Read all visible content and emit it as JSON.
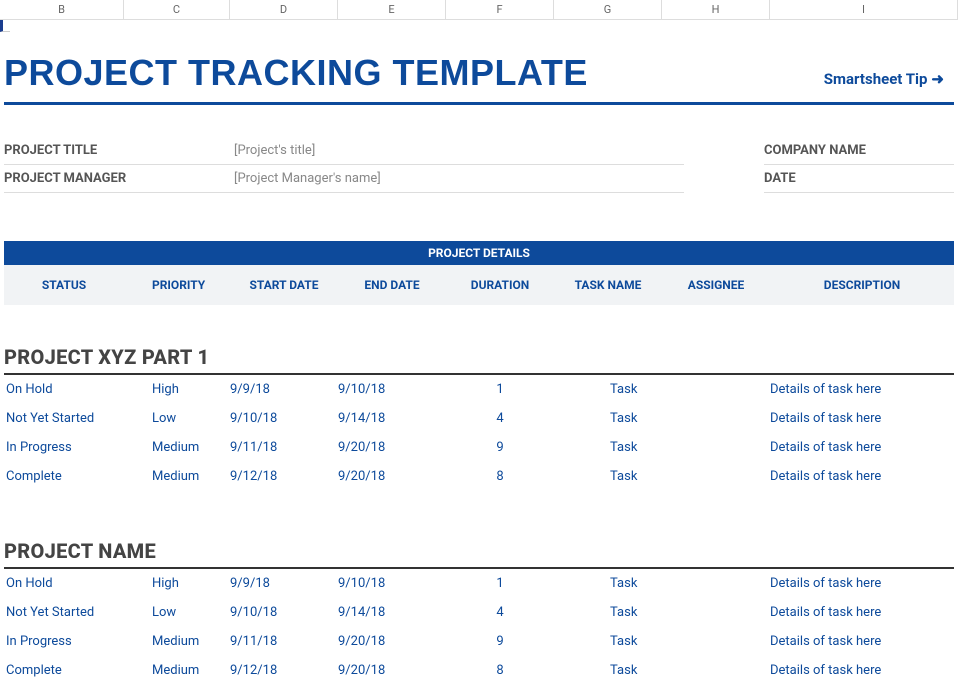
{
  "columns": [
    "B",
    "C",
    "D",
    "E",
    "F",
    "G",
    "H",
    "I"
  ],
  "title": "PROJECT TRACKING TEMPLATE",
  "tip": "Smartsheet Tip",
  "meta": {
    "project_title_label": "PROJECT TITLE",
    "project_title_value": "[Project's title]",
    "company_name_label": "COMPANY NAME",
    "project_manager_label": "PROJECT MANAGER",
    "project_manager_value": "[Project Manager's name]",
    "date_label": "DATE"
  },
  "details_banner": "PROJECT DETAILS",
  "details_headers": {
    "status": "STATUS",
    "priority": "PRIORITY",
    "start": "START DATE",
    "end": "END DATE",
    "duration": "DURATION",
    "task": "TASK NAME",
    "assignee": "ASSIGNEE",
    "desc": "DESCRIPTION"
  },
  "sections": [
    {
      "name": "PROJECT XYZ PART 1",
      "rows": [
        {
          "status": "On Hold",
          "priority": "High",
          "start": "9/9/18",
          "end": "9/10/18",
          "duration": "1",
          "task": "Task",
          "assignee": "",
          "desc": "Details of task here"
        },
        {
          "status": "Not Yet Started",
          "priority": "Low",
          "start": "9/10/18",
          "end": "9/14/18",
          "duration": "4",
          "task": "Task",
          "assignee": "",
          "desc": "Details of task here"
        },
        {
          "status": "In Progress",
          "priority": "Medium",
          "start": "9/11/18",
          "end": "9/20/18",
          "duration": "9",
          "task": "Task",
          "assignee": "",
          "desc": "Details of task here"
        },
        {
          "status": "Complete",
          "priority": "Medium",
          "start": "9/12/18",
          "end": "9/20/18",
          "duration": "8",
          "task": "Task",
          "assignee": "",
          "desc": "Details of task here"
        }
      ]
    },
    {
      "name": "PROJECT NAME",
      "rows": [
        {
          "status": "On Hold",
          "priority": "High",
          "start": "9/9/18",
          "end": "9/10/18",
          "duration": "1",
          "task": "Task",
          "assignee": "",
          "desc": "Details of task here"
        },
        {
          "status": "Not Yet Started",
          "priority": "Low",
          "start": "9/10/18",
          "end": "9/14/18",
          "duration": "4",
          "task": "Task",
          "assignee": "",
          "desc": "Details of task here"
        },
        {
          "status": "In Progress",
          "priority": "Medium",
          "start": "9/11/18",
          "end": "9/20/18",
          "duration": "9",
          "task": "Task",
          "assignee": "",
          "desc": "Details of task here"
        },
        {
          "status": "Complete",
          "priority": "Medium",
          "start": "9/12/18",
          "end": "9/20/18",
          "duration": "8",
          "task": "Task",
          "assignee": "",
          "desc": "Details of task here"
        }
      ]
    }
  ]
}
